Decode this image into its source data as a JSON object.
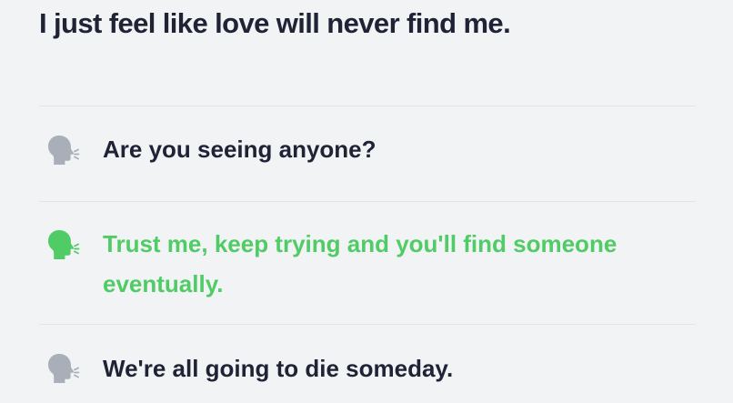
{
  "prompt": {
    "text": "I just feel like love will never find me."
  },
  "options": [
    {
      "label": "Are you seeing anyone?",
      "icon": "speaking-head-icon",
      "selected": false
    },
    {
      "label": "Trust me, keep trying and you'll find someone eventually.",
      "icon": "speaking-head-icon",
      "selected": true
    },
    {
      "label": "We're all going to die someday.",
      "icon": "speaking-head-icon",
      "selected": false
    }
  ],
  "colors": {
    "background": "#f2f3f5",
    "text": "#1f2335",
    "selected": "#4fcc66",
    "icon_default": "#a9afb8",
    "divider": "#e1e3e8"
  }
}
